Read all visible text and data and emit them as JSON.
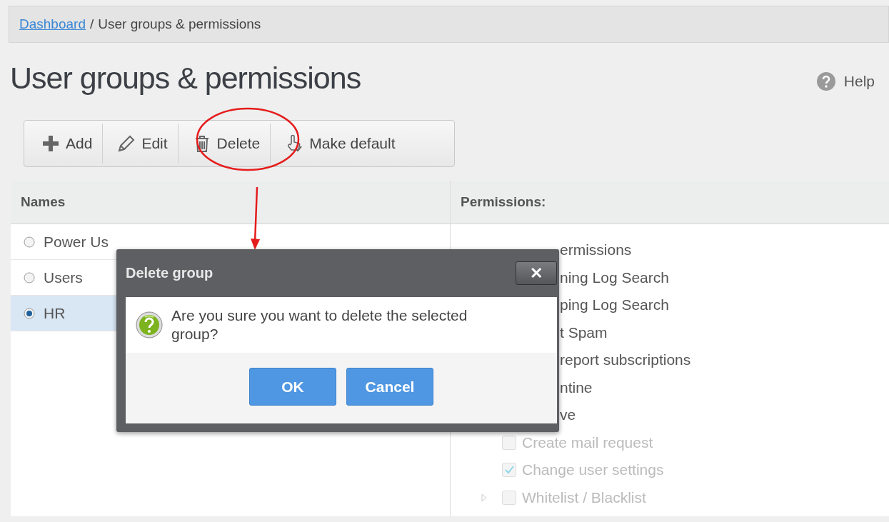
{
  "breadcrumb": {
    "link": "Dashboard",
    "separator": "/",
    "current": "User groups & permissions"
  },
  "page": {
    "title": "User groups & permissions",
    "help": "Help"
  },
  "toolbar": [
    {
      "label": "Add"
    },
    {
      "label": "Edit"
    },
    {
      "label": "Delete"
    },
    {
      "label": "Make default"
    }
  ],
  "names": {
    "header": "Names",
    "rows": [
      {
        "label": "Power Us",
        "selected": false
      },
      {
        "label": "Users",
        "selected": false
      },
      {
        "label": "HR",
        "selected": true
      }
    ]
  },
  "permissions": {
    "header": "Permissions:",
    "items": [
      {
        "kind": "covered",
        "label": "ermissions"
      },
      {
        "kind": "covered",
        "label": "ning Log Search"
      },
      {
        "kind": "covered",
        "label": "ping Log Search"
      },
      {
        "kind": "covered",
        "label": "t Spam"
      },
      {
        "kind": "covered",
        "label": "report subscriptions"
      },
      {
        "kind": "covered",
        "label": "ntine"
      },
      {
        "kind": "covered",
        "label": "ve"
      },
      {
        "kind": "checkbox",
        "label": "Create mail request",
        "checked": false,
        "disabled": true
      },
      {
        "kind": "checkbox",
        "label": "Change user settings",
        "checked": true,
        "disabled": true
      },
      {
        "kind": "expandable",
        "label": "Whitelist / Blacklist",
        "checked": false,
        "disabled": true
      }
    ]
  },
  "dialog": {
    "title": "Delete group",
    "close": "✕",
    "message": "Are you sure you want to delete the selected group?",
    "buttons": [
      "OK",
      "Cancel"
    ]
  }
}
